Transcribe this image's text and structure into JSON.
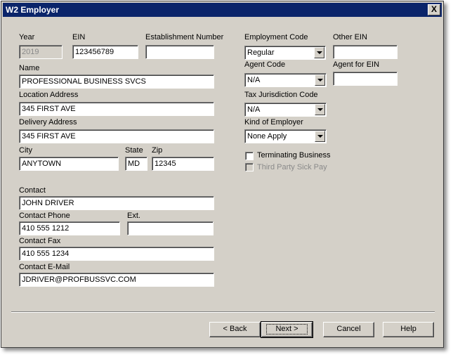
{
  "window": {
    "title": "W2 Employer",
    "close_label": "X"
  },
  "labels": {
    "year": "Year",
    "ein": "EIN",
    "establishment": "Establishment Number",
    "name": "Name",
    "location": "Location Address",
    "delivery": "Delivery Address",
    "city": "City",
    "state": "State",
    "zip": "Zip",
    "contact": "Contact",
    "contact_phone": "Contact Phone",
    "ext": "Ext.",
    "contact_fax": "Contact Fax",
    "contact_email": "Contact E-Mail",
    "employment_code": "Employment Code",
    "other_ein": "Other EIN",
    "agent_code": "Agent Code",
    "agent_for_ein": "Agent for EIN",
    "tax_jurisdiction": "Tax Jurisdiction Code",
    "kind_of_employer": "Kind of Employer",
    "terminating": "Terminating Business",
    "third_party": "Third Party Sick Pay"
  },
  "values": {
    "year": "2019",
    "ein": "123456789",
    "establishment": "",
    "name": "PROFESSIONAL BUSINESS SVCS",
    "location": "345 FIRST AVE",
    "delivery": "345 FIRST AVE",
    "city": "ANYTOWN",
    "state": "MD",
    "zip": "12345",
    "contact": "JOHN DRIVER",
    "contact_phone": "410 555 1212",
    "ext": "",
    "contact_fax": "410 555 1234",
    "contact_email": "JDRIVER@PROFBUSSVC.COM",
    "employment_code": "Regular",
    "other_ein": "",
    "agent_code": "N/A",
    "agent_for_ein": "",
    "tax_jurisdiction": "N/A",
    "kind_of_employer": "None Apply",
    "terminating": false,
    "third_party": false
  },
  "buttons": {
    "back": "< Back",
    "next": "Next >",
    "cancel": "Cancel",
    "help": "Help"
  }
}
